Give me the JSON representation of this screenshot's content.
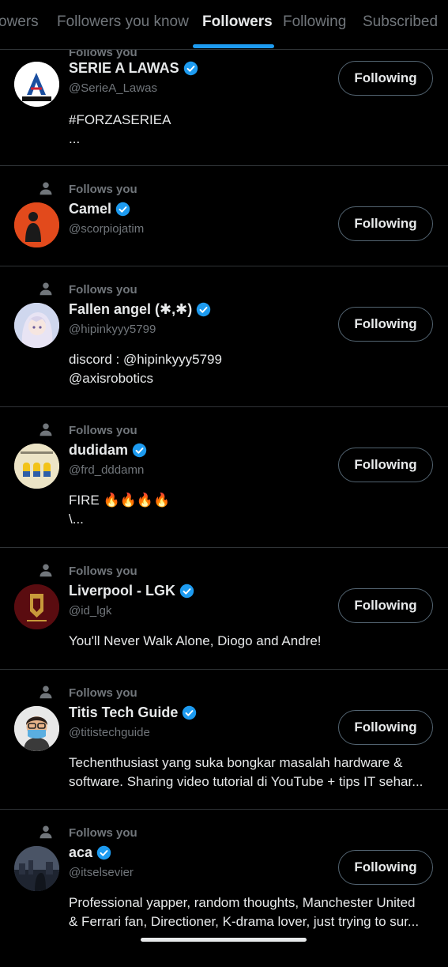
{
  "tabs": [
    {
      "label": "owers",
      "active": false
    },
    {
      "label": "Followers you know",
      "active": false
    },
    {
      "label": "Followers",
      "active": true
    },
    {
      "label": "Following",
      "active": false
    },
    {
      "label": "Subscribed",
      "active": false
    }
  ],
  "colors": {
    "accent": "#1d9bf0",
    "background": "#000000",
    "text_primary": "#e7e9ea",
    "text_secondary": "#71767b",
    "divider": "#2f3336"
  },
  "follows_you_label": "Follows you",
  "button_label": "Following",
  "users": [
    {
      "follows_you": "Follows you",
      "name": "SERIE A LAWAS",
      "handle": "@SerieA_Lawas",
      "verified": true,
      "bio": "#FORZASERIEA\n...",
      "avatar_icon": "serie-a-logo"
    },
    {
      "follows_you": "Follows you",
      "name": "Camel",
      "handle": "@scorpiojatim",
      "verified": true,
      "bio": "",
      "avatar_icon": "person-photo-orange"
    },
    {
      "follows_you": "Follows you",
      "name": "Fallen angel (✱,✱)",
      "handle": "@hipinkyyy5799",
      "verified": true,
      "bio": "discord : @hipinkyyy5799\n@axisrobotics",
      "avatar_icon": "anime-girl"
    },
    {
      "follows_you": "Follows you",
      "name": "dudidam",
      "handle": "@frd_dddamn",
      "verified": true,
      "bio": "FIRE 🔥🔥🔥🔥\n\\...",
      "avatar_icon": "minions"
    },
    {
      "follows_you": "Follows you",
      "name": "Liverpool - LGK",
      "handle": "@id_lgk",
      "verified": true,
      "bio": "You'll Never Walk Alone, Diogo and Andre!",
      "avatar_icon": "liverpool-crest"
    },
    {
      "follows_you": "Follows you",
      "name": "Titis Tech Guide",
      "handle": "@titistechguide",
      "verified": true,
      "bio": "Techenthusiast yang suka bongkar masalah hardware &\nsoftware. Sharing video tutorial di YouTube + tips IT sehar...",
      "avatar_icon": "cartoon-man-mask"
    },
    {
      "follows_you": "Follows you",
      "name": "aca",
      "handle": "@itselsevier",
      "verified": true,
      "bio": "Professional yapper, random thoughts, Manchester United\n& Ferrari fan, Directioner, K-drama lover, just trying to sur...",
      "avatar_icon": "city-night-photo"
    }
  ]
}
